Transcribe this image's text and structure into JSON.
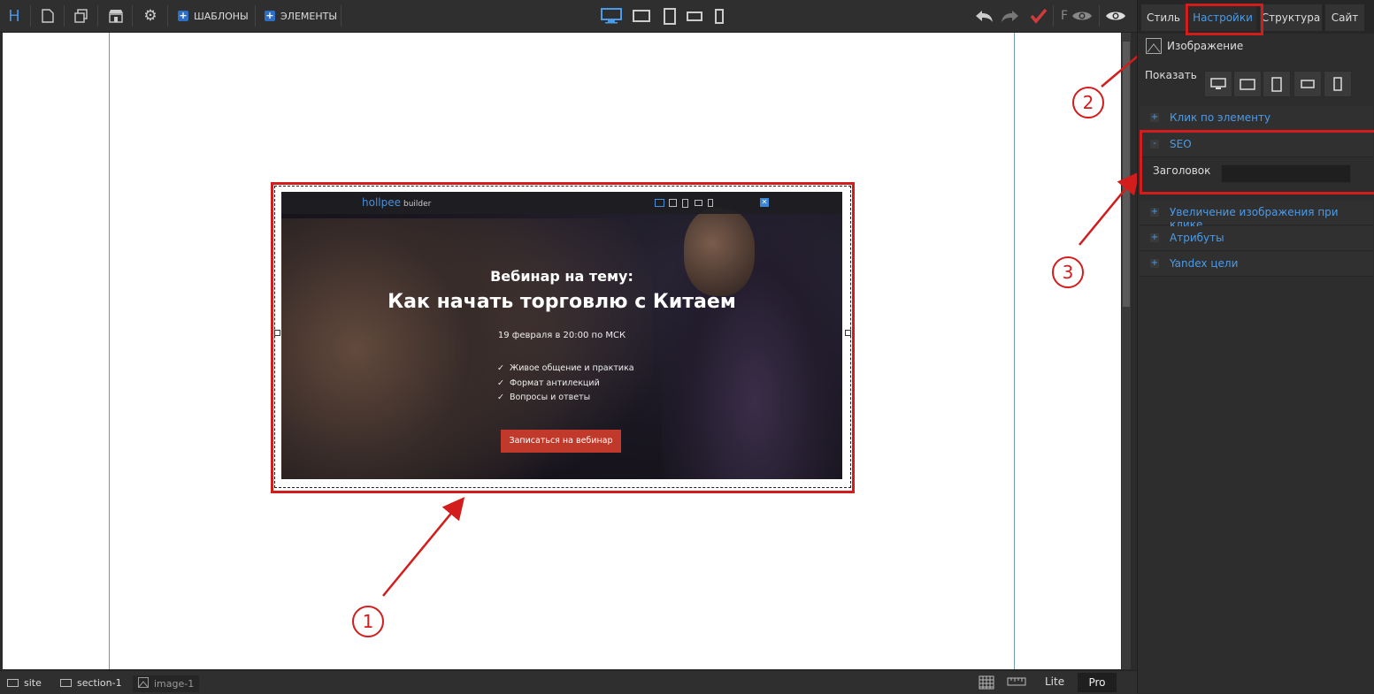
{
  "toolbar": {
    "logo": "H",
    "templates_label": "ШАБЛОНЫ",
    "elements_label": "ЭЛЕМЕНТЫ",
    "font_label": "F"
  },
  "webinar": {
    "logo": "hollpee",
    "logo_suffix": "builder",
    "subtitle": "Вебинар на тему:",
    "title": "Как начать торговлю с Китаем",
    "date": "19 февраля в 20:00 по МСК",
    "bullets": [
      "Живое общение и практика",
      "Формат антилекций",
      "Вопросы и ответы"
    ],
    "cta": "Записаться на вебинар"
  },
  "callouts": [
    "1",
    "2",
    "3"
  ],
  "panel": {
    "tabs": [
      "Стиль",
      "Настройки",
      "Структура",
      "Сайт"
    ],
    "active_tab": "Настройки",
    "element_label": "Изображение",
    "show_label": "Показать",
    "sections": [
      {
        "sign": "+",
        "label": "Клик по элементу"
      },
      {
        "sign": "-",
        "label": "SEO"
      },
      {
        "sign": "+",
        "label": "Увеличение изображения при клике"
      },
      {
        "sign": "+",
        "label": "Атрибуты"
      },
      {
        "sign": "+",
        "label": "Yandex цели"
      }
    ],
    "seo_field_label": "Заголовок",
    "seo_field_value": ""
  },
  "statusbar": {
    "breadcrumbs": [
      "site",
      "section-1",
      "image-1"
    ],
    "lite_label": "Lite",
    "pro_label": "Pro"
  },
  "colors": {
    "accent": "#4a9bea",
    "highlight": "#d31d1d",
    "cta": "#c0392b"
  }
}
